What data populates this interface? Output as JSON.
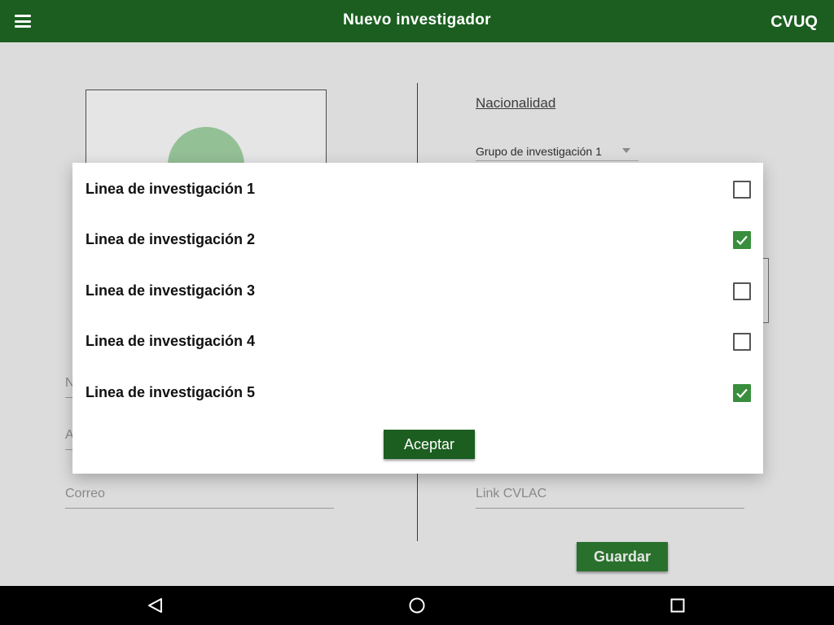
{
  "app_bar": {
    "title": "Nuevo investigador",
    "brand": "CVUQ",
    "menu_icon": "hamburger-menu-icon"
  },
  "form": {
    "nationality_link": "Nacionalidad",
    "group_select": {
      "selected": "Grupo de investigación 1"
    },
    "name_partial": "N",
    "lastname_partial": "A",
    "email_placeholder": "Correo",
    "cvlac_placeholder": "Link CVLAC",
    "save_label": "Guardar"
  },
  "dialog": {
    "lines": [
      {
        "label": "Linea de investigación 1",
        "checked": false
      },
      {
        "label": "Linea de investigación 2",
        "checked": true
      },
      {
        "label": "Linea de investigación 3",
        "checked": false
      },
      {
        "label": "Linea de investigación 4",
        "checked": false
      },
      {
        "label": "Linea de investigación 5",
        "checked": true
      }
    ],
    "accept_label": "Aceptar"
  },
  "colors": {
    "primary": "#1b5e20",
    "checkbox_checked": "#388e3c",
    "avatar": "#a5d6a7"
  },
  "nav_bar": {
    "back_icon": "back-triangle-icon",
    "home_icon": "home-circle-icon",
    "recent_icon": "recent-apps-square-icon"
  }
}
